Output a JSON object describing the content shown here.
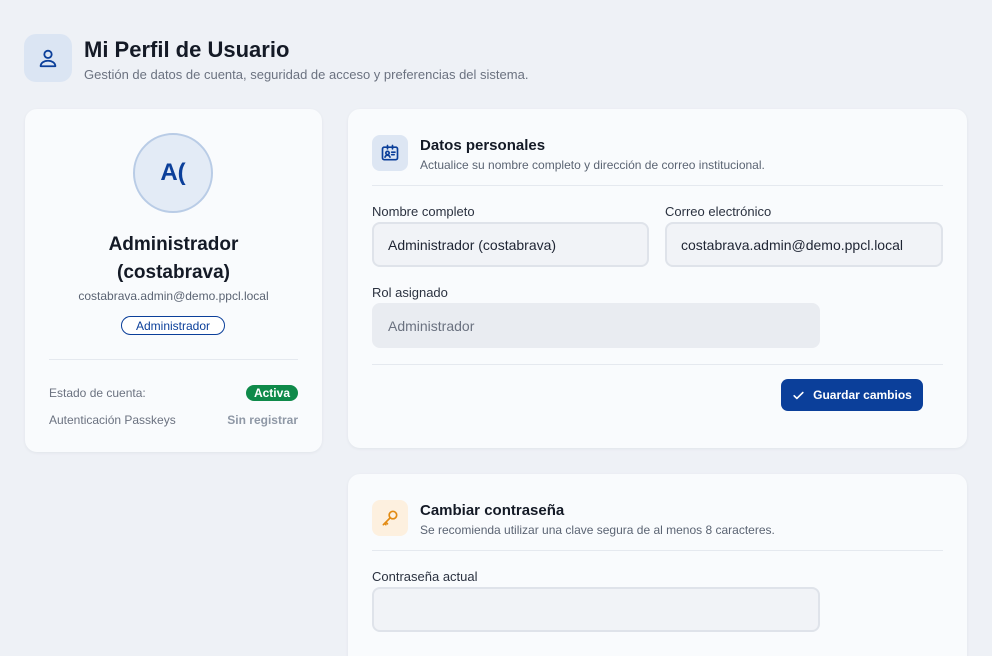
{
  "header": {
    "title": "Mi Perfil de Usuario",
    "subtitle": "Gestión de datos de cuenta, seguridad de acceso y preferencias del sistema.",
    "icon": "user-icon"
  },
  "profile": {
    "avatar_initials": "A(",
    "name": "Administrador (costabrava)",
    "email": "costabrava.admin@demo.ppcl.local",
    "role_badge": "Administrador",
    "account_status_label": "Estado de cuenta:",
    "account_status_value": "Activa",
    "passkeys_label": "Autenticación Passkeys",
    "passkeys_value": "Sin registrar"
  },
  "personal_data": {
    "icon": "id-card-icon",
    "title": "Datos personales",
    "description": "Actualice su nombre completo y dirección de correo institucional.",
    "full_name_label": "Nombre completo",
    "full_name_value": "Administrador (costabrava)",
    "email_label": "Correo electrónico",
    "email_value": "costabrava.admin@demo.ppcl.local",
    "role_label": "Rol asignado",
    "role_value": "Administrador",
    "save_label": "Guardar cambios"
  },
  "change_password": {
    "icon": "key-icon",
    "title": "Cambiar contraseña",
    "description": "Se recomienda utilizar una clave segura de al menos 8 caracteres.",
    "current_label": "Contraseña actual",
    "current_value": ""
  },
  "colors": {
    "brand": "#0b3f9a",
    "active_status": "#0f8a4a",
    "background": "#eef1f6",
    "key_icon": "#e28a12"
  }
}
